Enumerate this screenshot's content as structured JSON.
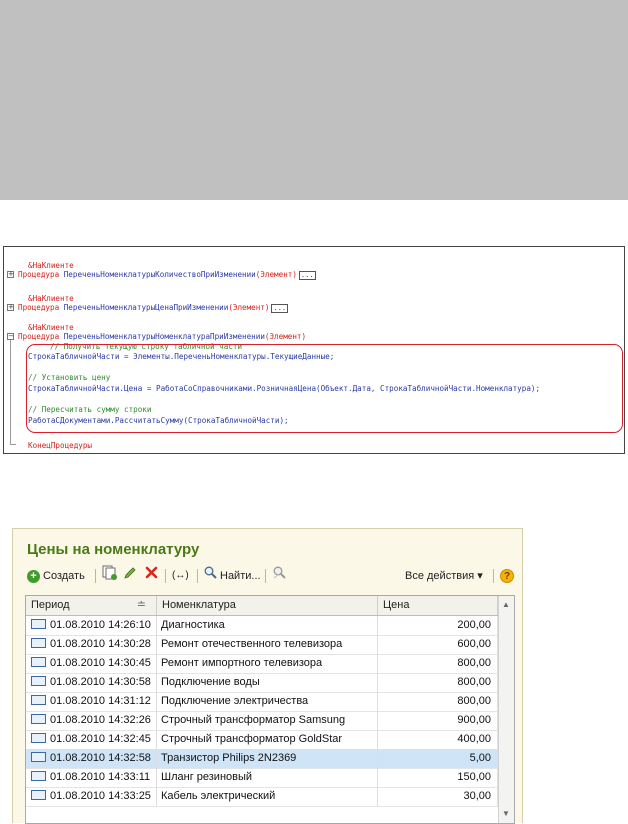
{
  "code": {
    "lines": [
      {
        "kind": "directive",
        "text": "&НаКлиенте"
      },
      {
        "kind": "proc",
        "keyword": "Процедура",
        "name": "ПереченьНоменклатурыКоличествоПриИзменении",
        "args": "(Элемент)",
        "ellipsis": "..."
      },
      {
        "kind": "directive",
        "text": "&НаКлиенте"
      },
      {
        "kind": "proc",
        "keyword": "Процедура",
        "name": "ПереченьНоменклатурыЦенаПриИзменении",
        "args": "(Элемент)",
        "ellipsis": "..."
      },
      {
        "kind": "directive",
        "text": "&НаКлиенте"
      },
      {
        "kind": "proc",
        "keyword": "Процедура",
        "name": "ПереченьНоменклатурыНоменклатураПриИзменении",
        "args": "(Элемент)"
      },
      {
        "kind": "comment",
        "text": "// Получить текущую строку табличной части"
      },
      {
        "kind": "code",
        "text": "СтрокаТабличнойЧасти = Элементы.ПереченьНоменклатуры.ТекущиеДанные;"
      },
      {
        "kind": "comment",
        "text": "// Установить цену"
      },
      {
        "kind": "code",
        "text": "СтрокаТабличнойЧасти.Цена = РаботаСоСправочниками.РозничнаяЦена(Объект.Дата, СтрокаТабличнойЧасти.Номенклатура);"
      },
      {
        "kind": "comment",
        "text": "// Пересчитать сумму строки"
      },
      {
        "kind": "code",
        "text": "РаботаСДокументами.РассчитатьСумму(СтрокаТабличнойЧасти);"
      },
      {
        "kind": "end",
        "text": "КонецПроцедуры"
      }
    ]
  },
  "form": {
    "title": "Цены на номенклатуру",
    "toolbar": {
      "create_label": "Создать",
      "plus_glyph": "+",
      "swap_label": "(↔)",
      "find_label": "Найти...",
      "all_actions_label": "Все действия ▾",
      "help_glyph": "?"
    },
    "icons": [
      "add-circle-icon",
      "copy-icon",
      "edit-pencil-icon",
      "delete-x-icon",
      "swap-icon",
      "search-icon",
      "clear-search-icon",
      "help-icon",
      "record-icon"
    ],
    "grid": {
      "columns": [
        "Период",
        "Номенклатура",
        "Цена"
      ],
      "sort_glyph": "≐",
      "rows": [
        {
          "period": "01.08.2010 14:26:10",
          "item": "Диагностика",
          "price": "200,00"
        },
        {
          "period": "01.08.2010 14:30:28",
          "item": "Ремонт отечественного телевизора",
          "price": "600,00"
        },
        {
          "period": "01.08.2010 14:30:45",
          "item": "Ремонт импортного телевизора",
          "price": "800,00"
        },
        {
          "period": "01.08.2010 14:30:58",
          "item": "Подключение воды",
          "price": "800,00"
        },
        {
          "period": "01.08.2010 14:31:12",
          "item": "Подключение электричества",
          "price": "800,00"
        },
        {
          "period": "01.08.2010 14:32:26",
          "item": "Строчный трансформатор Samsung",
          "price": "900,00"
        },
        {
          "period": "01.08.2010 14:32:45",
          "item": "Строчный трансформатор GoldStar",
          "price": "400,00"
        },
        {
          "period": "01.08.2010 14:32:58",
          "item": "Транзистор Philips 2N2369",
          "price": "5,00",
          "selected": true
        },
        {
          "period": "01.08.2010 14:33:11",
          "item": "Шланг резиновый",
          "price": "150,00"
        },
        {
          "period": "01.08.2010 14:33:25",
          "item": "Кабель электрический",
          "price": "30,00"
        }
      ]
    }
  },
  "colors": {
    "keyword": "#d2231c",
    "comment": "#2d8a2d",
    "code": "#2c3aa8",
    "title": "#4a7a15",
    "selection": "#cfe5f7",
    "highlight": "#d6202c"
  }
}
